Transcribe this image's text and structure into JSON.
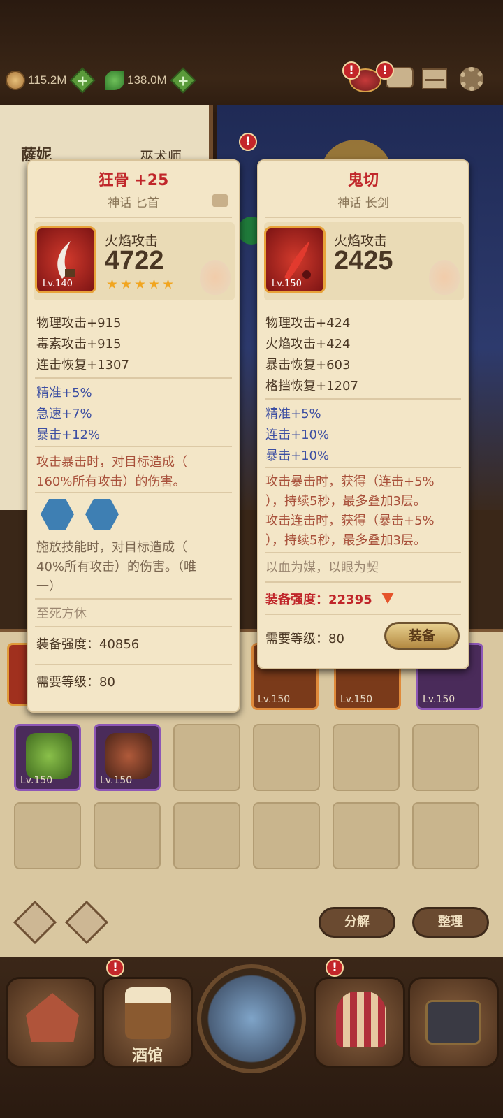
{
  "topbar": {
    "gold_amount": "115.2M",
    "leaf_amount": "138.0M",
    "gold_icon_color": "#c89b5a",
    "leaf_icon_color": "#3f8f3a",
    "badge_mark": "!"
  },
  "background": {
    "hero_name": "薩妮",
    "hero_class": "巫术师"
  },
  "left_card": {
    "name": "狂骨 +25",
    "rarity_type": "神话 匕首",
    "level": "Lv.140",
    "element_label": "火焰攻击",
    "element_value": "4722",
    "star_count": 5,
    "stats": [
      "物理攻击+915",
      "毒素攻击+915",
      "连击恢复+1307"
    ],
    "bonus_stats": [
      "精准+5%",
      "急速+7%",
      "暴击+12%"
    ],
    "effect": "攻击暴击时，对目标造成（\n160%所有攻击）的伤害。",
    "skill_text": "施放技能时，对目标造成（\n40%所有攻击）的伤害。（唯\n一）",
    "flavor": "至死方休",
    "power": "装备强度：40856",
    "required_level": "需要等级：80"
  },
  "right_card": {
    "name": "鬼切",
    "rarity_type": "神话 长剑",
    "level": "Lv.150",
    "element_label": "火焰攻击",
    "element_value": "2425",
    "stats": [
      "物理攻击+424",
      "火焰攻击+424",
      "暴击恢复+603",
      "格挡恢复+1207"
    ],
    "bonus_stats": [
      "精准+5%",
      "连击+10%",
      "暴击+10%"
    ],
    "effect1": "攻击暴击时，获得（连击+5%\n），持续5秒，最多叠加3层。",
    "effect2": "攻击连击时，获得（暴击+5%\n），持续5秒，最多叠加3层。",
    "flavor": "以血为媒，以眼为契",
    "power": "装备强度：22395",
    "required_level": "需要等级：80",
    "equip_label": "装备"
  },
  "inventory": {
    "top_row_levels": [
      "Lv.150",
      "Lv.150",
      "Lv.150"
    ],
    "items": [
      {
        "level": "Lv.150",
        "color": "#5b8a2e"
      },
      {
        "level": "Lv.150",
        "color": "#7a3e2a"
      }
    ],
    "decompose_label": "分解",
    "sort_label": "整理"
  },
  "nav": {
    "tavern_label": "酒馆"
  }
}
